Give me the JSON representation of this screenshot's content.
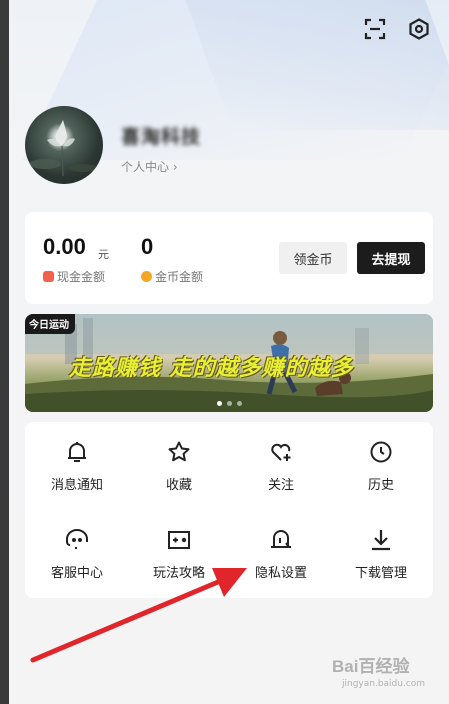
{
  "header": {
    "icons": [
      "scan-icon",
      "settings-hex-icon"
    ]
  },
  "profile": {
    "username": "喜淘科技",
    "personal_center": "个人中心 ›"
  },
  "wallet": {
    "cash_amount": "0.00",
    "cash_unit": "元",
    "cash_label": "现金金额",
    "coin_amount": "0",
    "coin_label": "金币金额",
    "claim_button": "领金币",
    "withdraw_button": "去提现",
    "colors": {
      "cash_icon": "#f0624b",
      "coin_icon": "#f5a623",
      "withdraw_bg": "#1c1c1c",
      "claim_bg": "#f0f0f0"
    }
  },
  "banner": {
    "tag": "今日运动",
    "text": "走路赚钱 走的越多赚的越多",
    "slide_count": 3,
    "active_slide": 1
  },
  "menu": {
    "items": [
      {
        "label": "消息通知",
        "icon": "bell-icon"
      },
      {
        "label": "收藏",
        "icon": "star-icon"
      },
      {
        "label": "关注",
        "icon": "heart-plus-icon"
      },
      {
        "label": "历史",
        "icon": "clock-icon"
      },
      {
        "label": "客服中心",
        "icon": "headset-icon"
      },
      {
        "label": "玩法攻略",
        "icon": "game-guide-icon"
      },
      {
        "label": "隐私设置",
        "icon": "privacy-lock-icon"
      },
      {
        "label": "下载管理",
        "icon": "download-icon"
      }
    ]
  },
  "annotation": {
    "arrow_color": "#e0262b"
  },
  "watermark": {
    "text": "Bai百经验",
    "sub": "jingyan.baidu.com"
  }
}
